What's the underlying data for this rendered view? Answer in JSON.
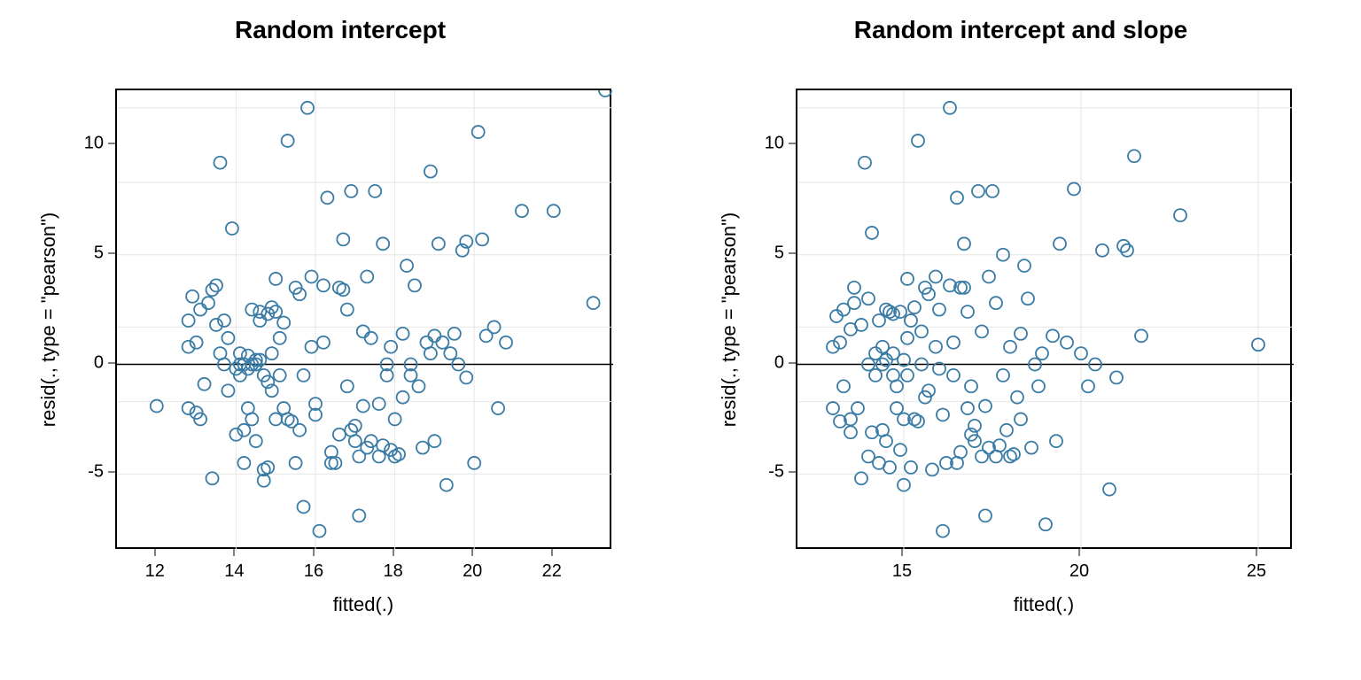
{
  "chart_data": [
    {
      "type": "scatter",
      "title": "Random intercept",
      "xlabel": "fitted(.)",
      "ylabel": "resid(., type = \"pearson\")",
      "xlim": [
        11,
        23.5
      ],
      "ylim": [
        -8.5,
        12.5
      ],
      "xticks": [
        12,
        14,
        16,
        18,
        20,
        22
      ],
      "yticks": [
        -5,
        0,
        5,
        10
      ],
      "grid_x": [
        14,
        16,
        18,
        20
      ],
      "grid_y": [
        -5,
        -1.7,
        1.7,
        5,
        8.3,
        11.7
      ],
      "zero_y": 0,
      "x": [
        12.0,
        12.8,
        12.8,
        12.8,
        12.9,
        13.0,
        13.0,
        13.1,
        13.1,
        13.2,
        13.3,
        13.4,
        13.4,
        13.5,
        13.5,
        13.6,
        13.6,
        13.7,
        13.7,
        13.8,
        13.8,
        13.9,
        14.0,
        14.0,
        14.1,
        14.1,
        14.1,
        14.2,
        14.2,
        14.2,
        14.3,
        14.3,
        14.3,
        14.4,
        14.4,
        14.4,
        14.5,
        14.5,
        14.5,
        14.6,
        14.6,
        14.6,
        14.7,
        14.7,
        14.7,
        14.8,
        14.8,
        14.8,
        14.9,
        14.9,
        14.9,
        15.0,
        15.0,
        15.0,
        15.1,
        15.1,
        15.2,
        15.2,
        15.3,
        15.3,
        15.4,
        15.5,
        15.5,
        15.6,
        15.6,
        15.7,
        15.7,
        15.8,
        15.9,
        15.9,
        16.0,
        16.0,
        16.1,
        16.2,
        16.2,
        16.3,
        16.4,
        16.4,
        16.5,
        16.6,
        16.6,
        16.7,
        16.7,
        16.8,
        16.8,
        16.9,
        16.9,
        17.0,
        17.0,
        17.1,
        17.1,
        17.2,
        17.2,
        17.3,
        17.3,
        17.4,
        17.4,
        17.5,
        17.6,
        17.6,
        17.7,
        17.7,
        17.8,
        17.8,
        17.9,
        17.9,
        18.0,
        18.0,
        18.1,
        18.2,
        18.2,
        18.3,
        18.4,
        18.4,
        18.5,
        18.6,
        18.7,
        18.8,
        18.9,
        18.9,
        19.0,
        19.0,
        19.1,
        19.2,
        19.3,
        19.4,
        19.5,
        19.6,
        19.7,
        19.8,
        19.8,
        20.0,
        20.1,
        20.2,
        20.3,
        20.5,
        20.6,
        20.8,
        21.2,
        22.0,
        23.0,
        23.3
      ],
      "y": [
        -1.9,
        0.8,
        -2.0,
        2.0,
        3.1,
        -2.2,
        1.0,
        2.5,
        -2.5,
        -0.9,
        2.8,
        3.4,
        -5.2,
        3.6,
        1.8,
        9.2,
        0.5,
        2.0,
        0.0,
        1.2,
        -1.2,
        6.2,
        -0.2,
        -3.2,
        -0.5,
        0.0,
        0.5,
        -4.5,
        -3.0,
        0.0,
        -0.2,
        0.4,
        -2.0,
        2.5,
        0.0,
        -2.5,
        -3.5,
        0.2,
        0.0,
        0.2,
        2.4,
        2.0,
        -0.5,
        -5.3,
        -4.8,
        2.3,
        -4.7,
        -0.8,
        2.6,
        -1.2,
        0.5,
        3.9,
        2.4,
        -2.5,
        1.2,
        -0.5,
        -2.0,
        1.9,
        10.2,
        -2.5,
        -2.6,
        3.5,
        -4.5,
        -3.0,
        3.2,
        -6.5,
        -0.5,
        11.7,
        4.0,
        0.8,
        -2.3,
        -1.8,
        -7.6,
        3.6,
        1.0,
        7.6,
        -4.5,
        -4.0,
        -4.5,
        -3.2,
        3.5,
        3.4,
        5.7,
        2.5,
        -1.0,
        7.9,
        -3.0,
        -2.8,
        -3.5,
        -4.2,
        -6.9,
        1.5,
        -1.9,
        -3.8,
        4.0,
        1.2,
        -3.5,
        7.9,
        -4.2,
        -1.8,
        -3.7,
        5.5,
        0.0,
        -0.5,
        0.8,
        -3.9,
        -2.5,
        -4.2,
        -4.1,
        -1.5,
        1.4,
        4.5,
        0.0,
        -0.5,
        3.6,
        -1.0,
        -3.8,
        1.0,
        0.5,
        8.8,
        1.3,
        -3.5,
        5.5,
        1.0,
        -5.5,
        0.5,
        1.4,
        0.0,
        5.2,
        -0.6,
        5.6,
        -4.5,
        10.6,
        5.7,
        1.3,
        1.7,
        -2.0,
        1.0,
        7.0,
        7.0,
        2.8
      ]
    },
    {
      "type": "scatter",
      "title": "Random intercept and slope",
      "xlabel": "fitted(.)",
      "ylabel": "resid(., type = \"pearson\")",
      "xlim": [
        12,
        26
      ],
      "ylim": [
        -8.5,
        12.5
      ],
      "xticks": [
        15,
        20,
        25
      ],
      "yticks": [
        -5,
        0,
        5,
        10
      ],
      "grid_x": [
        15,
        20,
        25
      ],
      "grid_y": [
        -5,
        -1.7,
        1.7,
        5,
        8.3,
        11.7
      ],
      "zero_y": 0,
      "x": [
        13.0,
        13.0,
        13.1,
        13.2,
        13.2,
        13.3,
        13.3,
        13.5,
        13.5,
        13.5,
        13.6,
        13.6,
        13.7,
        13.8,
        13.8,
        13.9,
        14.0,
        14.0,
        14.0,
        14.1,
        14.1,
        14.2,
        14.2,
        14.3,
        14.3,
        14.4,
        14.4,
        14.4,
        14.5,
        14.5,
        14.5,
        14.6,
        14.6,
        14.7,
        14.7,
        14.7,
        14.8,
        14.8,
        14.9,
        14.9,
        15.0,
        15.0,
        15.0,
        15.1,
        15.1,
        15.1,
        15.2,
        15.2,
        15.3,
        15.3,
        15.4,
        15.4,
        15.5,
        15.5,
        15.6,
        15.6,
        15.7,
        15.7,
        15.8,
        15.9,
        15.9,
        16.0,
        16.0,
        16.1,
        16.1,
        16.2,
        16.3,
        16.3,
        16.4,
        16.4,
        16.5,
        16.5,
        16.6,
        16.6,
        16.7,
        16.7,
        16.8,
        16.8,
        16.9,
        16.9,
        17.0,
        17.0,
        17.1,
        17.2,
        17.2,
        17.3,
        17.3,
        17.4,
        17.4,
        17.5,
        17.6,
        17.6,
        17.7,
        17.8,
        17.8,
        17.9,
        18.0,
        18.0,
        18.1,
        18.2,
        18.3,
        18.3,
        18.4,
        18.5,
        18.6,
        18.7,
        18.8,
        18.9,
        19.0,
        19.2,
        19.3,
        19.4,
        19.6,
        19.8,
        20.0,
        20.2,
        20.4,
        20.6,
        20.8,
        21.0,
        21.2,
        21.3,
        21.5,
        21.7,
        22.8,
        25.0
      ],
      "y": [
        -2.0,
        0.8,
        2.2,
        -2.6,
        1.0,
        2.5,
        -1.0,
        -3.1,
        -2.5,
        1.6,
        2.8,
        3.5,
        -2.0,
        -5.2,
        1.8,
        9.2,
        3.0,
        -4.2,
        0.0,
        -3.1,
        6.0,
        -0.5,
        0.5,
        2.0,
        -4.5,
        0.8,
        -3.0,
        0.0,
        -3.5,
        2.5,
        0.2,
        2.4,
        -4.7,
        -0.5,
        2.3,
        0.5,
        -1.0,
        -2.0,
        2.4,
        -3.9,
        0.2,
        -5.5,
        -2.5,
        3.9,
        1.2,
        -0.5,
        -4.7,
        2.0,
        2.6,
        -2.5,
        10.2,
        -2.6,
        1.5,
        0.0,
        -1.5,
        3.5,
        3.2,
        -1.2,
        -4.8,
        4.0,
        0.8,
        2.5,
        -0.2,
        -7.6,
        -2.3,
        -4.5,
        11.7,
        3.6,
        1.0,
        -0.5,
        -4.5,
        7.6,
        -4.0,
        3.5,
        3.5,
        5.5,
        2.4,
        -2.0,
        -3.2,
        -1.0,
        -3.5,
        -2.8,
        7.9,
        -4.2,
        1.5,
        -1.9,
        -6.9,
        -3.8,
        4.0,
        7.9,
        -4.2,
        2.8,
        -3.7,
        5.0,
        -0.5,
        -3.0,
        -4.2,
        0.8,
        -4.1,
        -1.5,
        1.4,
        -2.5,
        4.5,
        3.0,
        -3.8,
        0.0,
        -1.0,
        0.5,
        -7.3,
        1.3,
        -3.5,
        5.5,
        1.0,
        8.0,
        0.5,
        -1.0,
        0.0,
        5.2,
        -5.7,
        -0.6,
        5.4,
        5.2,
        9.5,
        1.3,
        6.8,
        0.9
      ]
    }
  ]
}
